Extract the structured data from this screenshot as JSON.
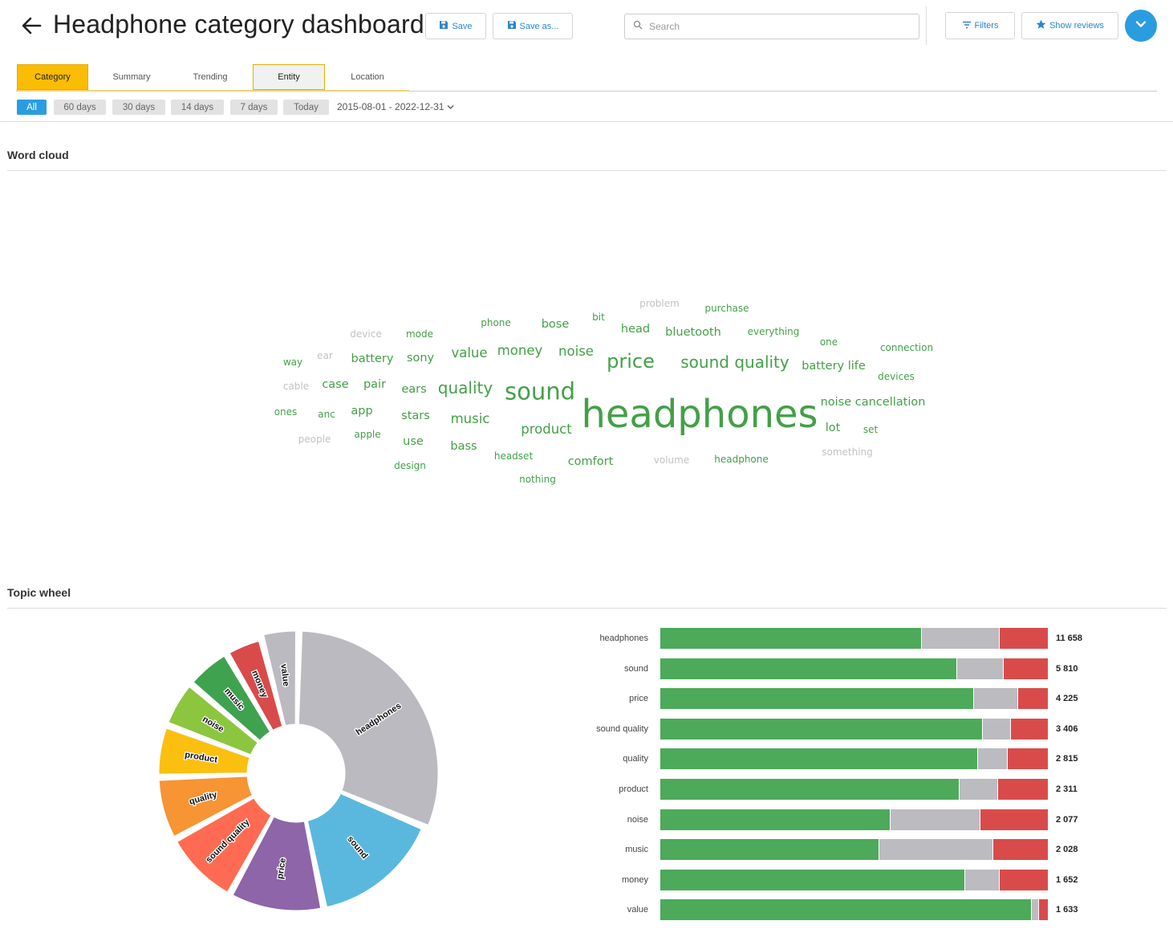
{
  "header": {
    "title": "Headphone category dashboard",
    "save_label": "Save",
    "save_as_label": "Save as...",
    "search_placeholder": "Search",
    "filters_label": "Filters",
    "show_reviews_label": "Show reviews"
  },
  "tabs": [
    {
      "label": "Category",
      "state": "active"
    },
    {
      "label": "Summary",
      "state": "normal"
    },
    {
      "label": "Trending",
      "state": "normal"
    },
    {
      "label": "Entity",
      "state": "boxed"
    },
    {
      "label": "Location",
      "state": "normal"
    }
  ],
  "time_filters": {
    "options": [
      "All",
      "60 days",
      "30 days",
      "14 days",
      "7 days",
      "Today"
    ],
    "selected": "All",
    "date_range": "2015-08-01 - 2022-12-31"
  },
  "word_cloud": {
    "title": "Word cloud",
    "words": [
      {
        "text": "problem",
        "weight": 1,
        "tone": "neutral"
      },
      {
        "text": "purchase",
        "weight": 1,
        "tone": "positive"
      },
      {
        "text": "phone",
        "weight": 1,
        "tone": "positive"
      },
      {
        "text": "bose",
        "weight": 2,
        "tone": "positive"
      },
      {
        "text": "bit",
        "weight": 1,
        "tone": "positive"
      },
      {
        "text": "head",
        "weight": 2,
        "tone": "positive"
      },
      {
        "text": "bluetooth",
        "weight": 2,
        "tone": "positive"
      },
      {
        "text": "everything",
        "weight": 1,
        "tone": "positive"
      },
      {
        "text": "device",
        "weight": 1,
        "tone": "neutral"
      },
      {
        "text": "mode",
        "weight": 1,
        "tone": "positive"
      },
      {
        "text": "one",
        "weight": 1,
        "tone": "positive"
      },
      {
        "text": "connection",
        "weight": 1,
        "tone": "positive"
      },
      {
        "text": "ear",
        "weight": 1,
        "tone": "neutral"
      },
      {
        "text": "way",
        "weight": 1,
        "tone": "positive"
      },
      {
        "text": "battery",
        "weight": 2,
        "tone": "positive"
      },
      {
        "text": "sony",
        "weight": 2,
        "tone": "positive"
      },
      {
        "text": "value",
        "weight": 3,
        "tone": "positive"
      },
      {
        "text": "money",
        "weight": 3,
        "tone": "positive"
      },
      {
        "text": "noise",
        "weight": 3,
        "tone": "positive"
      },
      {
        "text": "price",
        "weight": 5,
        "tone": "positive"
      },
      {
        "text": "sound quality",
        "weight": 4,
        "tone": "positive"
      },
      {
        "text": "battery life",
        "weight": 2,
        "tone": "positive"
      },
      {
        "text": "devices",
        "weight": 1,
        "tone": "positive"
      },
      {
        "text": "cable",
        "weight": 1,
        "tone": "neutral"
      },
      {
        "text": "case",
        "weight": 2,
        "tone": "positive"
      },
      {
        "text": "pair",
        "weight": 2,
        "tone": "positive"
      },
      {
        "text": "ears",
        "weight": 2,
        "tone": "positive"
      },
      {
        "text": "quality",
        "weight": 4,
        "tone": "positive"
      },
      {
        "text": "sound",
        "weight": 6,
        "tone": "positive"
      },
      {
        "text": "headphones",
        "weight": 9,
        "tone": "positive"
      },
      {
        "text": "noise cancellation",
        "weight": 2,
        "tone": "positive"
      },
      {
        "text": "ones",
        "weight": 1,
        "tone": "positive"
      },
      {
        "text": "anc",
        "weight": 1,
        "tone": "positive"
      },
      {
        "text": "app",
        "weight": 2,
        "tone": "positive"
      },
      {
        "text": "stars",
        "weight": 2,
        "tone": "positive"
      },
      {
        "text": "music",
        "weight": 3,
        "tone": "positive"
      },
      {
        "text": "product",
        "weight": 3,
        "tone": "positive"
      },
      {
        "text": "lot",
        "weight": 2,
        "tone": "positive"
      },
      {
        "text": "set",
        "weight": 1,
        "tone": "positive"
      },
      {
        "text": "people",
        "weight": 1,
        "tone": "neutral"
      },
      {
        "text": "apple",
        "weight": 1,
        "tone": "positive"
      },
      {
        "text": "use",
        "weight": 2,
        "tone": "positive"
      },
      {
        "text": "bass",
        "weight": 2,
        "tone": "positive"
      },
      {
        "text": "headset",
        "weight": 1,
        "tone": "positive"
      },
      {
        "text": "something",
        "weight": 1,
        "tone": "neutral"
      },
      {
        "text": "comfort",
        "weight": 2,
        "tone": "positive"
      },
      {
        "text": "volume",
        "weight": 1,
        "tone": "neutral"
      },
      {
        "text": "headphone",
        "weight": 1,
        "tone": "positive"
      },
      {
        "text": "design",
        "weight": 1,
        "tone": "positive"
      },
      {
        "text": "nothing",
        "weight": 1,
        "tone": "positive"
      }
    ],
    "colors": {
      "positive": "#43a047",
      "neutral": "#c2c2c2"
    }
  },
  "topic_wheel": {
    "title": "Topic wheel",
    "colors": {
      "positive": "#4caa5a",
      "neutral": "#bbbbc0",
      "negative": "#d94b4b"
    },
    "slices": [
      {
        "label": "headphones",
        "value": 11658,
        "color": "#babac0"
      },
      {
        "label": "sound",
        "value": 5810,
        "color": "#5ab8de"
      },
      {
        "label": "price",
        "value": 4225,
        "color": "#8e65a8"
      },
      {
        "label": "sound quality",
        "value": 3406,
        "color": "#ff6b52"
      },
      {
        "label": "quality",
        "value": 2815,
        "color": "#f79433"
      },
      {
        "label": "product",
        "value": 2311,
        "color": "#fbbf0f"
      },
      {
        "label": "noise",
        "value": 2077,
        "color": "#8cc63f"
      },
      {
        "label": "music",
        "value": 2028,
        "color": "#3fa24f"
      },
      {
        "label": "money",
        "value": 1652,
        "color": "#d94b4b"
      },
      {
        "label": "value",
        "value": 1633,
        "color": "#babac0"
      }
    ],
    "bars": [
      {
        "label": "headphones",
        "count": "11 658",
        "positive": 0.673,
        "neutral": 0.203,
        "negative": 0.124
      },
      {
        "label": "sound",
        "count": "5 810",
        "positive": 0.765,
        "neutral": 0.122,
        "negative": 0.113
      },
      {
        "label": "price",
        "count": "4 225",
        "positive": 0.808,
        "neutral": 0.115,
        "negative": 0.077
      },
      {
        "label": "sound quality",
        "count": "3 406",
        "positive": 0.83,
        "neutral": 0.075,
        "negative": 0.095
      },
      {
        "label": "quality",
        "count": "2 815",
        "positive": 0.818,
        "neutral": 0.078,
        "negative": 0.104
      },
      {
        "label": "product",
        "count": "2 311",
        "positive": 0.77,
        "neutral": 0.102,
        "negative": 0.128
      },
      {
        "label": "noise",
        "count": "2 077",
        "positive": 0.592,
        "neutral": 0.235,
        "negative": 0.173
      },
      {
        "label": "music",
        "count": "2 028",
        "positive": 0.563,
        "neutral": 0.297,
        "negative": 0.14
      },
      {
        "label": "money",
        "count": "1 652",
        "positive": 0.785,
        "neutral": 0.091,
        "negative": 0.124
      },
      {
        "label": "value",
        "count": "1 633",
        "positive": 0.957,
        "neutral": 0.02,
        "negative": 0.023
      }
    ]
  }
}
